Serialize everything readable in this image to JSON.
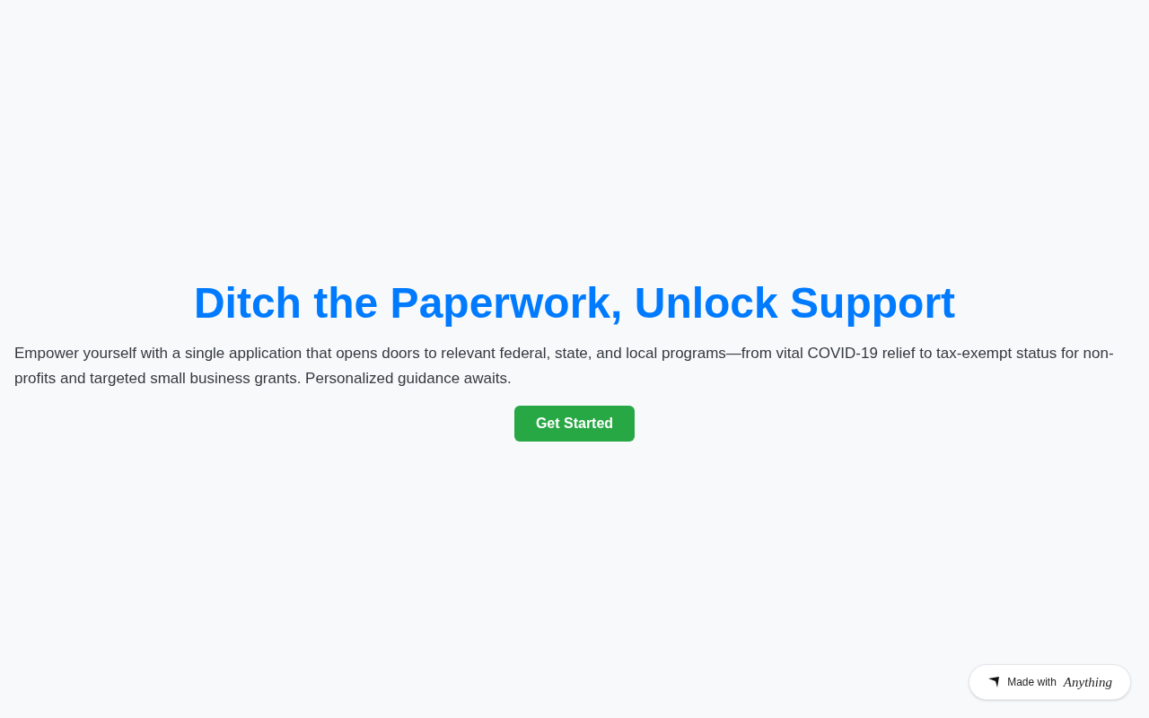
{
  "hero": {
    "title": "Ditch the Paperwork, Unlock Support",
    "description": "Empower yourself with a single application that opens doors to relevant federal, state, and local programs—from vital COVID-19 relief to tax-exempt status for non-profits and targeted small business grants. Personalized guidance awaits.",
    "button": "Get Started"
  },
  "badge": {
    "prefix": "Made with",
    "brand": "Anything"
  }
}
